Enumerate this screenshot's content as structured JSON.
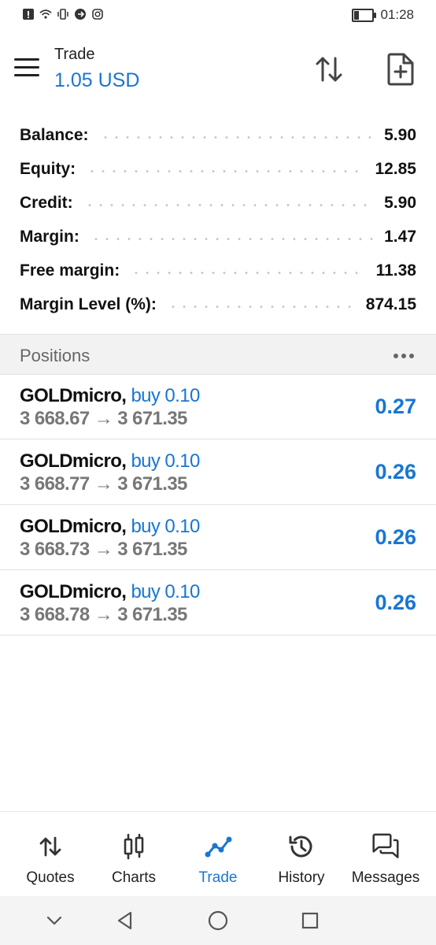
{
  "status_bar": {
    "time": "01:28"
  },
  "header": {
    "title": "Trade",
    "balance": "1.05 USD"
  },
  "account": [
    {
      "label": "Balance:",
      "value": "5.90"
    },
    {
      "label": "Equity:",
      "value": "12.85"
    },
    {
      "label": "Credit:",
      "value": "5.90"
    },
    {
      "label": "Margin:",
      "value": "1.47"
    },
    {
      "label": "Free margin:",
      "value": "11.38"
    },
    {
      "label": "Margin Level (%):",
      "value": "874.15"
    }
  ],
  "positions": {
    "title": "Positions",
    "items": [
      {
        "symbol": "GOLDmicro,",
        "side": "buy 0.10",
        "open": "3 668.67",
        "current": "3 671.35",
        "profit": "0.27"
      },
      {
        "symbol": "GOLDmicro,",
        "side": "buy 0.10",
        "open": "3 668.77",
        "current": "3 671.35",
        "profit": "0.26"
      },
      {
        "symbol": "GOLDmicro,",
        "side": "buy 0.10",
        "open": "3 668.73",
        "current": "3 671.35",
        "profit": "0.26"
      },
      {
        "symbol": "GOLDmicro,",
        "side": "buy 0.10",
        "open": "3 668.78",
        "current": "3 671.35",
        "profit": "0.26"
      }
    ]
  },
  "nav": {
    "items": [
      {
        "label": "Quotes",
        "icon": "quotes-icon"
      },
      {
        "label": "Charts",
        "icon": "charts-icon"
      },
      {
        "label": "Trade",
        "icon": "trade-icon",
        "active": true
      },
      {
        "label": "History",
        "icon": "history-icon"
      },
      {
        "label": "Messages",
        "icon": "messages-icon"
      }
    ]
  },
  "colors": {
    "accent": "#1976d2",
    "text": "#111111",
    "muted": "#777777"
  }
}
